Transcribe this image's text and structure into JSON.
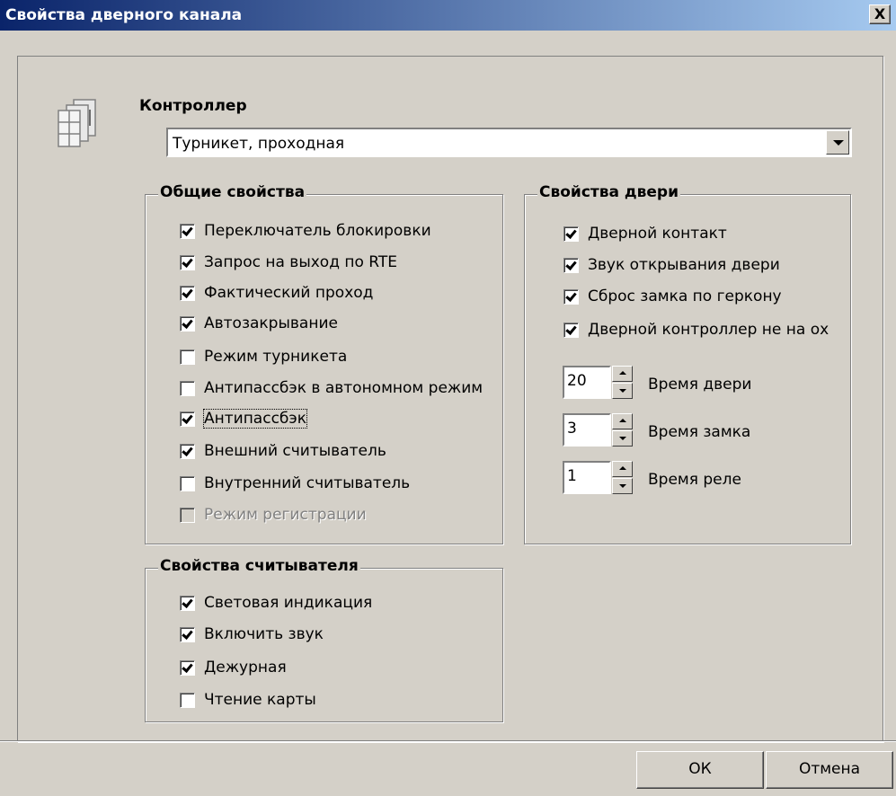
{
  "window": {
    "title": "Свойства дверного канала",
    "close_label": "X"
  },
  "controller": {
    "label": "Контроллер",
    "selected": "Турникет, проходная"
  },
  "general": {
    "title": "Общие свойства",
    "items": [
      {
        "label": "Переключатель блокировки",
        "checked": true
      },
      {
        "label": "Запрос на выход по RTE",
        "checked": true
      },
      {
        "label": "Фактический проход",
        "checked": true
      },
      {
        "label": "Автозакрывание",
        "checked": true
      },
      {
        "label": "Режим турникета",
        "checked": false
      },
      {
        "label": "Антипассбэк в автономном режим",
        "checked": false
      },
      {
        "label": "Антипассбэк",
        "checked": true,
        "focused": true
      },
      {
        "label": "Внешний считыватель",
        "checked": true
      },
      {
        "label": "Внутренний считыватель",
        "checked": false
      },
      {
        "label": "Режим регистрации",
        "checked": false,
        "disabled": true
      }
    ]
  },
  "door": {
    "title": "Свойства двери",
    "items": [
      {
        "label": "Дверной контакт",
        "checked": true
      },
      {
        "label": "Звук открывания двери",
        "checked": true
      },
      {
        "label": "Сброс замка по геркону",
        "checked": true
      },
      {
        "label": "Дверной контроллер не на ох",
        "checked": true
      }
    ],
    "spinners": [
      {
        "value": "20",
        "label": "Время двери"
      },
      {
        "value": "3",
        "label": "Время замка"
      },
      {
        "value": "1",
        "label": "Время реле"
      }
    ]
  },
  "reader": {
    "title": "Свойства считывателя",
    "items": [
      {
        "label": "Световая индикация",
        "checked": true
      },
      {
        "label": "Включить звук",
        "checked": true
      },
      {
        "label": "Дежурная",
        "checked": true
      },
      {
        "label": "Чтение карты",
        "checked": false
      }
    ]
  },
  "buttons": {
    "ok": "ОК",
    "cancel": "Отмена"
  }
}
